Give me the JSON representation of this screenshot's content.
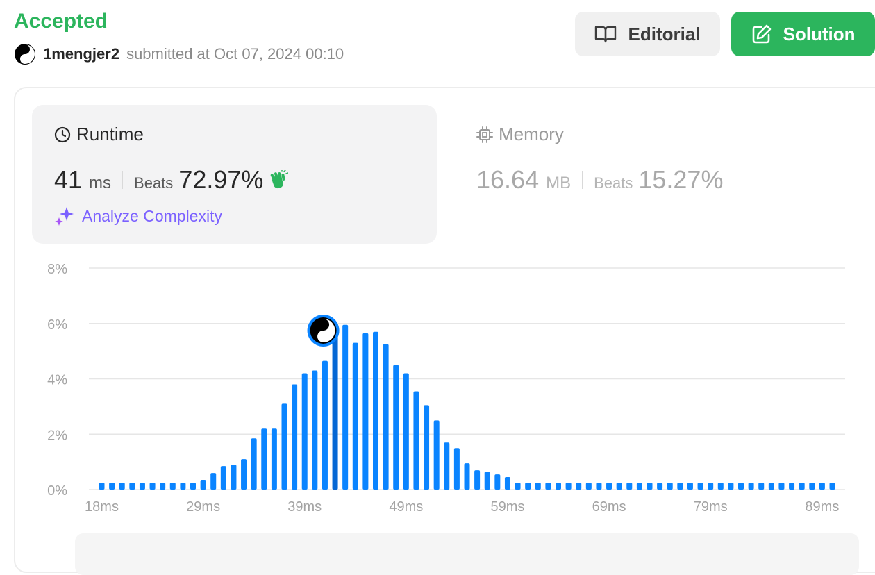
{
  "header": {
    "status": "Accepted",
    "username": "1mengjer2",
    "submitted_text": "submitted at Oct 07, 2024 00:10"
  },
  "buttons": {
    "editorial": "Editorial",
    "solution": "Solution"
  },
  "runtime": {
    "title": "Runtime",
    "value": "41",
    "unit": "ms",
    "beats_label": "Beats",
    "beats_value": "72.97%",
    "analyze_label": "Analyze Complexity"
  },
  "memory": {
    "title": "Memory",
    "value": "16.64",
    "unit": "MB",
    "beats_label": "Beats",
    "beats_value": "15.27%"
  },
  "colors": {
    "accent_green": "#2cb55d",
    "bar_blue": "#0a84ff",
    "highlight_bar": "#0567d4",
    "analyze_purple": "#7b61ff"
  },
  "chart_data": {
    "type": "bar",
    "ylim": [
      0,
      8
    ],
    "yticks": [
      "0%",
      "2%",
      "4%",
      "6%",
      "8%"
    ],
    "xtick_labels": [
      "18ms",
      "29ms",
      "39ms",
      "49ms",
      "59ms",
      "69ms",
      "79ms",
      "89ms"
    ],
    "grid": true,
    "highlight_index": 23,
    "highlight_label": "41ms",
    "values": [
      0.25,
      0.25,
      0.25,
      0.25,
      0.25,
      0.25,
      0.25,
      0.25,
      0.25,
      0.25,
      0.35,
      0.6,
      0.85,
      0.9,
      1.1,
      1.85,
      2.2,
      2.2,
      3.1,
      3.8,
      4.2,
      4.3,
      4.65,
      5.55,
      5.95,
      5.3,
      5.65,
      5.7,
      5.25,
      4.5,
      4.2,
      3.55,
      3.05,
      2.5,
      1.7,
      1.5,
      0.95,
      0.7,
      0.65,
      0.55,
      0.45,
      0.25,
      0.25,
      0.25,
      0.25,
      0.25,
      0.25,
      0.25,
      0.25,
      0.25,
      0.25,
      0.25,
      0.25,
      0.25,
      0.25,
      0.25,
      0.25,
      0.25,
      0.25,
      0.25,
      0.25,
      0.25,
      0.25,
      0.25,
      0.25,
      0.25,
      0.25,
      0.25,
      0.25,
      0.25,
      0.25,
      0.25,
      0.25
    ]
  }
}
